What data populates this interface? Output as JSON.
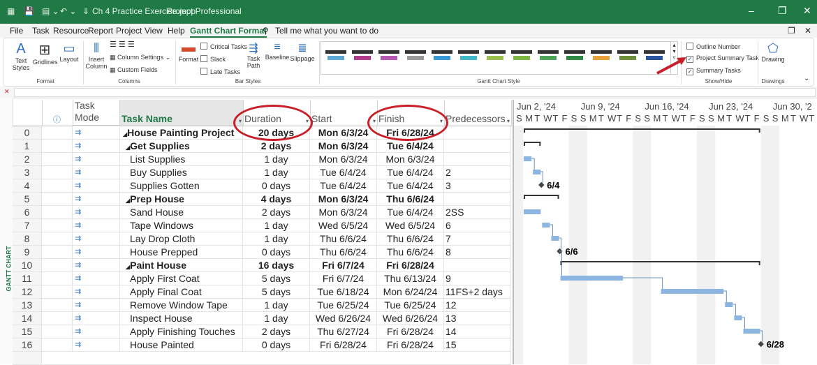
{
  "titlebar": {
    "doc_title": "Ch 4 Practice Exercise.mpp",
    "app_name": "Project Professional"
  },
  "menu": [
    "File",
    "Task",
    "Resource",
    "Report",
    "Project",
    "View",
    "Help",
    "Gantt Chart Format"
  ],
  "search": {
    "placeholder": "Tell me what you want to do"
  },
  "ribbon": {
    "text_styles": "Text Styles",
    "gridlines": "Gridlines",
    "layout": "Layout",
    "insert_column": "Insert Column",
    "column_settings": "Column Settings",
    "custom_fields": "Custom Fields",
    "critical_tasks": "Critical Tasks",
    "slack": "Slack",
    "late_tasks": "Late Tasks",
    "format": "Format",
    "task_path": "Task Path",
    "baseline": "Baseline",
    "slippage": "Slippage",
    "outline_number": "Outline Number",
    "project_summary_task": "Project Summary Task",
    "summary_tasks": "Summary Tasks",
    "drawing": "Drawing",
    "groups": {
      "format": "Format",
      "columns": "Columns",
      "bar_styles": "Bar Styles",
      "gantt_chart_style": "Gantt Chart Style",
      "show_hide": "Show/Hide",
      "drawings": "Drawings"
    }
  },
  "side_label": "GANTT CHART",
  "columns": {
    "mode": "Task Mode",
    "name": "Task Name",
    "duration": "Duration",
    "start": "Start",
    "finish": "Finish",
    "pred": "Predecessors"
  },
  "tasks": [
    {
      "id": "0",
      "name": "House Painting Project",
      "duration": "20 days",
      "start": "Mon 6/3/24",
      "finish": "Fri 6/28/24",
      "pred": "",
      "level": 0,
      "summary": true
    },
    {
      "id": "1",
      "name": "Get Supplies",
      "duration": "2 days",
      "start": "Mon 6/3/24",
      "finish": "Tue 6/4/24",
      "pred": "",
      "level": 1,
      "summary": true
    },
    {
      "id": "2",
      "name": "List Supplies",
      "duration": "1 day",
      "start": "Mon 6/3/24",
      "finish": "Mon 6/3/24",
      "pred": "",
      "level": 2,
      "summary": false
    },
    {
      "id": "3",
      "name": "Buy Supplies",
      "duration": "1 day",
      "start": "Tue 6/4/24",
      "finish": "Tue 6/4/24",
      "pred": "2",
      "level": 2,
      "summary": false
    },
    {
      "id": "4",
      "name": "Supplies Gotten",
      "duration": "0 days",
      "start": "Tue 6/4/24",
      "finish": "Tue 6/4/24",
      "pred": "3",
      "level": 2,
      "summary": false
    },
    {
      "id": "5",
      "name": "Prep House",
      "duration": "4 days",
      "start": "Mon 6/3/24",
      "finish": "Thu 6/6/24",
      "pred": "",
      "level": 1,
      "summary": true
    },
    {
      "id": "6",
      "name": "Sand House",
      "duration": "2 days",
      "start": "Mon 6/3/24",
      "finish": "Tue 6/4/24",
      "pred": "2SS",
      "level": 2,
      "summary": false
    },
    {
      "id": "7",
      "name": "Tape Windows",
      "duration": "1 day",
      "start": "Wed 6/5/24",
      "finish": "Wed 6/5/24",
      "pred": "6",
      "level": 2,
      "summary": false
    },
    {
      "id": "8",
      "name": "Lay Drop Cloth",
      "duration": "1 day",
      "start": "Thu 6/6/24",
      "finish": "Thu 6/6/24",
      "pred": "7",
      "level": 2,
      "summary": false
    },
    {
      "id": "9",
      "name": "House Prepped",
      "duration": "0 days",
      "start": "Thu 6/6/24",
      "finish": "Thu 6/6/24",
      "pred": "8",
      "level": 2,
      "summary": false
    },
    {
      "id": "10",
      "name": "Paint House",
      "duration": "16 days",
      "start": "Fri 6/7/24",
      "finish": "Fri 6/28/24",
      "pred": "",
      "level": 1,
      "summary": true
    },
    {
      "id": "11",
      "name": "Apply First Coat",
      "duration": "5 days",
      "start": "Fri 6/7/24",
      "finish": "Thu 6/13/24",
      "pred": "9",
      "level": 2,
      "summary": false
    },
    {
      "id": "12",
      "name": "Apply Final Coat",
      "duration": "5 days",
      "start": "Tue 6/18/24",
      "finish": "Mon 6/24/24",
      "pred": "11FS+2 days",
      "level": 2,
      "summary": false
    },
    {
      "id": "13",
      "name": "Remove Window Tape",
      "duration": "1 day",
      "start": "Tue 6/25/24",
      "finish": "Tue 6/25/24",
      "pred": "12",
      "level": 2,
      "summary": false
    },
    {
      "id": "14",
      "name": "Inspect House",
      "duration": "1 day",
      "start": "Wed 6/26/24",
      "finish": "Wed 6/26/24",
      "pred": "13",
      "level": 2,
      "summary": false
    },
    {
      "id": "15",
      "name": "Apply Finishing Touches",
      "duration": "2 days",
      "start": "Thu 6/27/24",
      "finish": "Fri 6/28/24",
      "pred": "14",
      "level": 2,
      "summary": false
    },
    {
      "id": "16",
      "name": "House Painted",
      "duration": "0 days",
      "start": "Fri 6/28/24",
      "finish": "Fri 6/28/24",
      "pred": "15",
      "level": 2,
      "summary": false
    }
  ],
  "timescale": {
    "weeks": [
      "Jun 2, '24",
      "Jun 9, '24",
      "Jun 16, '24",
      "Jun 23, '24",
      "Jun 30, '2"
    ],
    "day_letters": [
      "S",
      "M",
      "T",
      "W",
      "T",
      "F",
      "S"
    ]
  },
  "milestone_labels": {
    "4": "6/4",
    "9": "6/6",
    "16": "6/28"
  },
  "colors": {
    "title_green": "#1f7a45",
    "bar_blue": "#8cb5e1",
    "highlight_red": "#c8202a"
  }
}
